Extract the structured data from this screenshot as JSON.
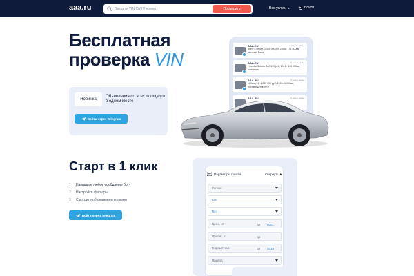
{
  "header": {
    "logo": "aaa.ru",
    "search_placeholder": "Введите VIN (БИН) номер",
    "check_button": "Проверить",
    "services": "Все услуги",
    "login": "Войти"
  },
  "hero": {
    "title_line1": "Бесплатная",
    "title_line2_prefix": "проверка ",
    "title_line2_vin": "VIN",
    "badge": "Новинка",
    "promo_text": "Объявления со всех площадок в одном месте",
    "tg_button": "Войти через Telegram"
  },
  "notifications": [
    {
      "app": "AAA.RU",
      "time": "2 минуты назад",
      "text": "BMW 6 серии, 1 460 000руб. 2006г. 171 000км, частник, 1 вла"
    },
    {
      "app": "AAA.RU",
      "time": "5 минут назад",
      "text": "Hyundai Solaris, 800 000 руб, 2015г. 136 000км, компания"
    },
    {
      "app": "AAA.RU",
      "time": "5 минут назад",
      "text": "LiXiang L6, 4 280 000 руб, 2024г. 5 000км, растаможен в пути"
    },
    {
      "app": "AAA.RU",
      "time": "6 минут назад",
      "text": ""
    }
  ],
  "start": {
    "title": "Старт в 1 клик",
    "steps": [
      {
        "num": "1",
        "text": "Напишите любое сообщение боту"
      },
      {
        "num": "2",
        "text": "Настройте фильтры"
      },
      {
        "num": "3",
        "text": "Смотрите объявления первыми"
      }
    ],
    "tg_button": "Войти через Telegram"
  },
  "search_panel": {
    "title": "Параметры поиска",
    "collapse": "Свернуть",
    "region_label": "Регион",
    "brand_value": "Kia",
    "model_value": "Rio",
    "price_label": "Цена, от",
    "price_to_label": "до",
    "price_to_value": "900...",
    "mileage_label": "Пробег, от",
    "mileage_to_label": "до",
    "year_label": "Год выпуска",
    "year_to_label": "до",
    "year_to_value": "2015",
    "drive_label": "Привод"
  }
}
